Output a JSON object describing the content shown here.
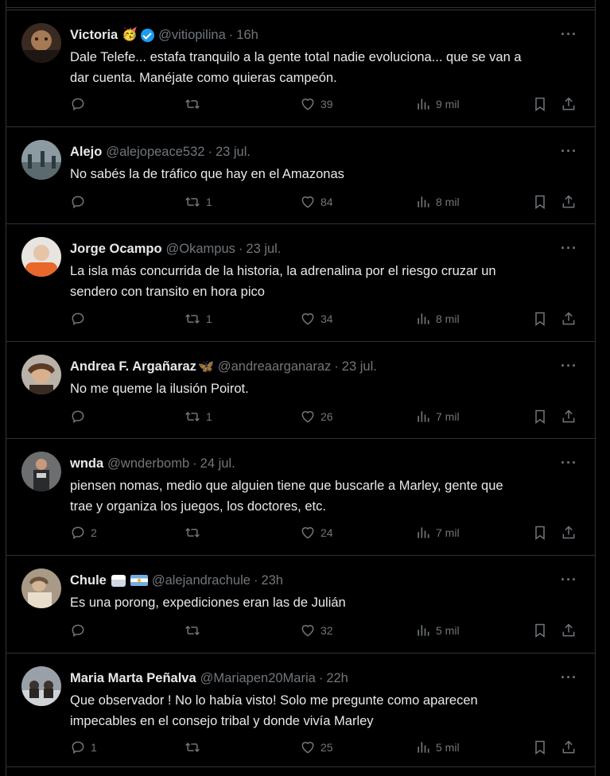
{
  "colors": {
    "background": "#000000",
    "text": "#e7e9ea",
    "muted": "#71767b",
    "border": "#2f3336",
    "verified": "#1d9bf0"
  },
  "icons": {
    "reply": "reply-icon",
    "retweet": "retweet-icon",
    "like": "heart-icon",
    "views": "views-icon",
    "bookmark": "bookmark-icon",
    "share": "share-icon",
    "more": "more-icon"
  },
  "more_label": "···",
  "tweets": [
    {
      "name": "Victoria",
      "badge": "🥳",
      "verified": true,
      "handle": "@vitiopilina",
      "sep": "·",
      "time": "16h",
      "lines": [
        "Dale Telefe... estafa tranquilo a la gente total nadie evoluciona... que se van a",
        "dar cuenta. Manéjate como quieras campeón."
      ],
      "replies": "",
      "retweets": "",
      "likes": "39",
      "views": "9 mil"
    },
    {
      "name": "Alejo",
      "handle": "@alejopeace532",
      "sep": "·",
      "time": "23 jul.",
      "lines": [
        "No sabés la de tráfico que hay en el Amazonas"
      ],
      "replies": "",
      "retweets": "1",
      "likes": "84",
      "views": "8 mil"
    },
    {
      "name": "Jorge Ocampo",
      "handle": "@Okampus",
      "sep": "·",
      "time": "23 jul.",
      "lines": [
        "La isla más concurrida de la historia, la adrenalina por el riesgo cruzar un",
        "sendero con transito en hora pico"
      ],
      "replies": "",
      "retweets": "1",
      "likes": "34",
      "views": "8 mil"
    },
    {
      "name": "Andrea F. Argañaraz",
      "badge": "🦋",
      "handle": "@andreaarganaraz",
      "sep": "·",
      "time": "23 jul.",
      "lines": [
        "No me queme la ilusión Poirot."
      ],
      "replies": "",
      "retweets": "1",
      "likes": "26",
      "views": "7 mil"
    },
    {
      "name": "wnda",
      "handle": "@wnderbomb",
      "sep": "·",
      "time": "24 jul.",
      "lines": [
        "piensen nomas, medio que alguien tiene que buscarle a Marley, gente que",
        "trae y organiza los juegos, los doctores, etc."
      ],
      "replies": "2",
      "retweets": "",
      "likes": "24",
      "views": "7 mil"
    },
    {
      "name": "Chule",
      "badge": "cake-flag",
      "handle": "@alejandrachule",
      "sep": "·",
      "time": "23h",
      "lines": [
        "Es una porong, expediciones eran las de Julián"
      ],
      "replies": "",
      "retweets": "",
      "likes": "32",
      "views": "5 mil"
    },
    {
      "name": "Maria Marta Peñalva",
      "handle": "@Mariapen20Maria",
      "sep": "·",
      "time": "22h",
      "lines": [
        "Que observador ! No lo había visto! Solo me pregunte como aparecen",
        "impecables en el consejo tribal y donde vivía Marley"
      ],
      "replies": "1",
      "retweets": "",
      "likes": "25",
      "views": "5 mil"
    }
  ]
}
